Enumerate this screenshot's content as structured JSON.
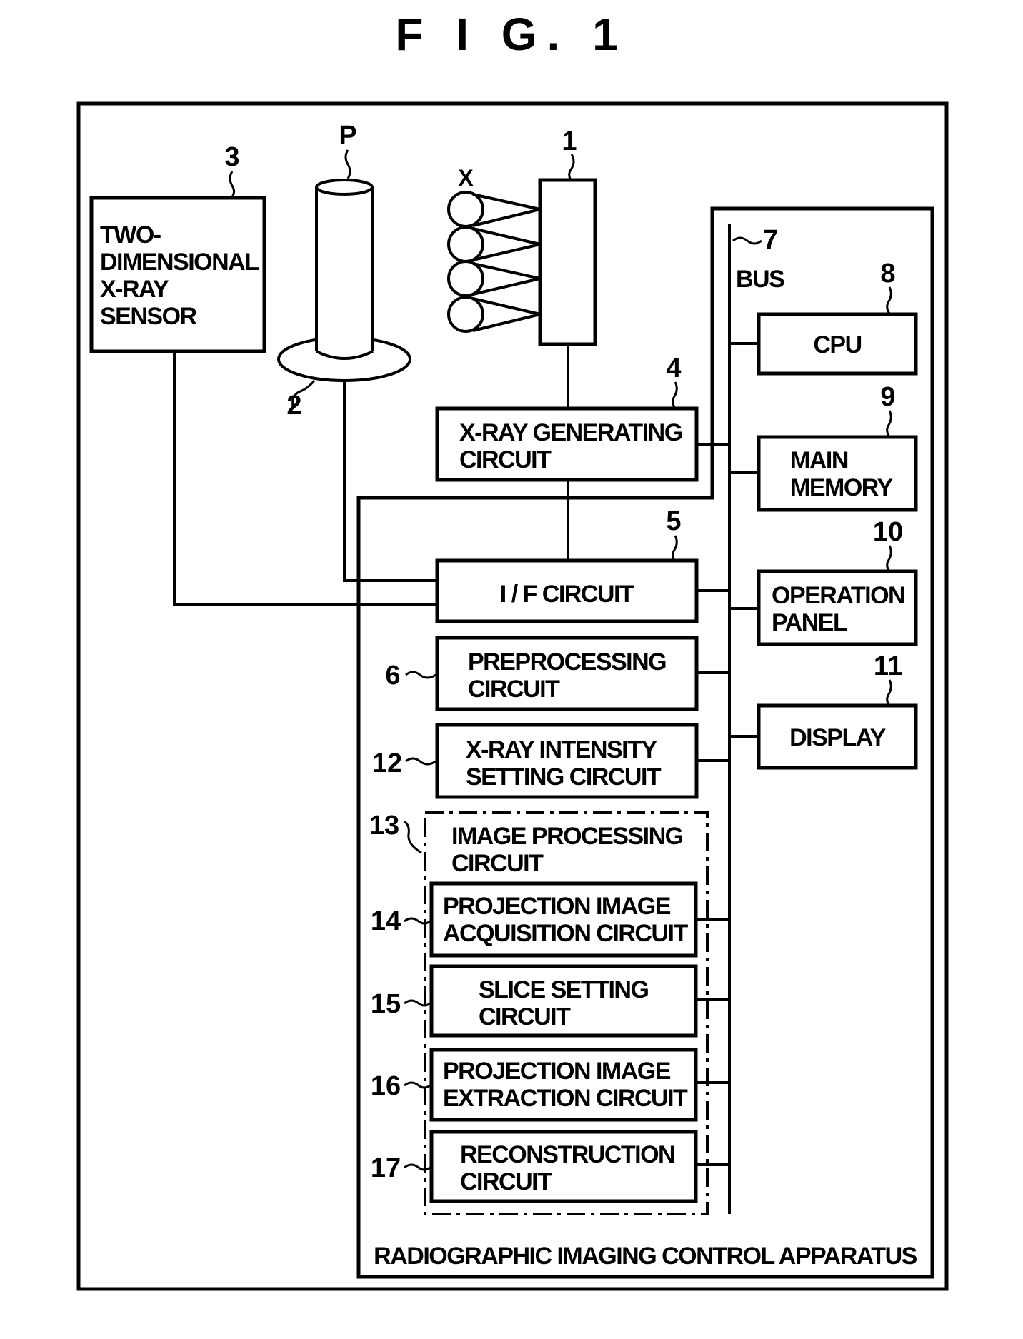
{
  "figure": {
    "title": "F I G. 1",
    "apparatus_label": "RADIOGRAPHIC IMAGING CONTROL APPARATUS"
  },
  "external": {
    "xray_source": {
      "ref": "1",
      "beam_label": "X"
    },
    "platform": {
      "ref": "2"
    },
    "sensor": {
      "ref": "3",
      "lines": [
        "TWO-",
        "DIMENSIONAL",
        "X-RAY",
        "SENSOR"
      ]
    },
    "patient": {
      "ref": "P"
    }
  },
  "bus": {
    "ref": "7",
    "label": "BUS"
  },
  "left_blocks": [
    {
      "ref": "4",
      "lines": [
        "X-RAY GENERATING",
        "CIRCUIT"
      ]
    },
    {
      "ref": "5",
      "lines": [
        "I / F CIRCUIT"
      ]
    },
    {
      "ref": "6",
      "lines": [
        "PREPROCESSING",
        "CIRCUIT"
      ]
    },
    {
      "ref": "12",
      "lines": [
        "X-RAY INTENSITY",
        "SETTING CIRCUIT"
      ]
    }
  ],
  "image_processing": {
    "ref": "13",
    "lines": [
      "IMAGE PROCESSING",
      "CIRCUIT"
    ],
    "children": [
      {
        "ref": "14",
        "lines": [
          "PROJECTION IMAGE",
          "ACQUISITION CIRCUIT"
        ]
      },
      {
        "ref": "15",
        "lines": [
          "SLICE SETTING",
          "CIRCUIT"
        ]
      },
      {
        "ref": "16",
        "lines": [
          "PROJECTION IMAGE",
          "EXTRACTION CIRCUIT"
        ]
      },
      {
        "ref": "17",
        "lines": [
          "RECONSTRUCTION",
          "CIRCUIT"
        ]
      }
    ]
  },
  "right_blocks": [
    {
      "ref": "8",
      "lines": [
        "CPU"
      ]
    },
    {
      "ref": "9",
      "lines": [
        "MAIN",
        "MEMORY"
      ]
    },
    {
      "ref": "10",
      "lines": [
        "OPERATION",
        "PANEL"
      ]
    },
    {
      "ref": "11",
      "lines": [
        "DISPLAY"
      ]
    }
  ]
}
